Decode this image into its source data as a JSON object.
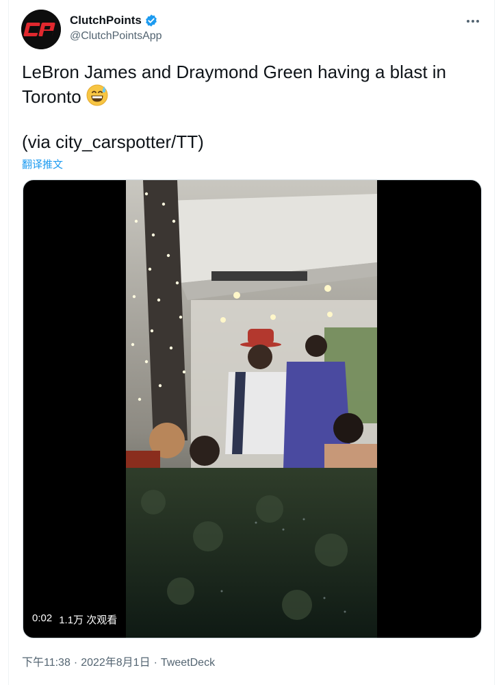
{
  "author": {
    "display_name": "ClutchPoints",
    "handle": "@ClutchPointsApp",
    "avatar_text": "CP",
    "verified": true,
    "verified_color": "#1d9bf0"
  },
  "menu": {
    "icon": "more-horizontal-icon"
  },
  "tweet": {
    "text": "LeBron James and Draymond Green having a blast in\nToronto",
    "emoji": "grinning-face-with-sweat-emoji",
    "source": "(via city_carspotter/TT)",
    "translate_label": "翻译推文"
  },
  "media": {
    "type": "video",
    "elapsed": "0:02",
    "views": "1.1万 次观看"
  },
  "footer": {
    "time": "下午11:38",
    "separator": "·",
    "date": "2022年8月1日",
    "client": "TweetDeck"
  },
  "colors": {
    "accent": "#1d9bf0",
    "text": "#0f1419",
    "secondary": "#536471",
    "brand_red": "#e0282e"
  }
}
